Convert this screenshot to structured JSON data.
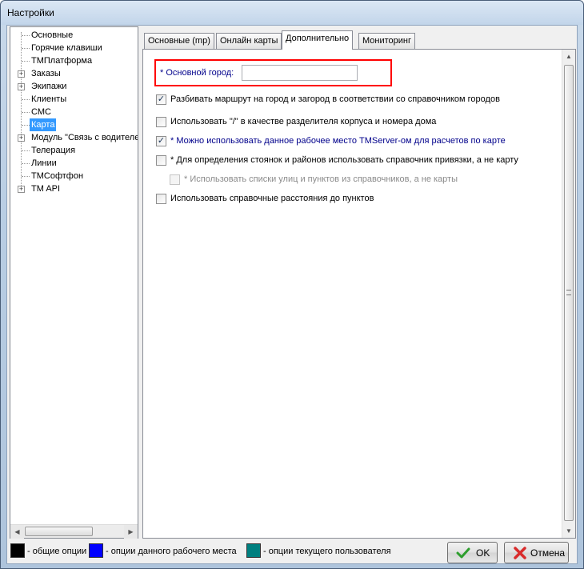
{
  "window": {
    "title": "Настройки"
  },
  "tree": {
    "items": [
      {
        "label": "Основные",
        "expandable": false,
        "selected": false
      },
      {
        "label": "Горячие клавиши",
        "expandable": false,
        "selected": false
      },
      {
        "label": "ТМПлатформа",
        "expandable": false,
        "selected": false
      },
      {
        "label": "Заказы",
        "expandable": true,
        "selected": false
      },
      {
        "label": "Экипажи",
        "expandable": true,
        "selected": false
      },
      {
        "label": "Клиенты",
        "expandable": false,
        "selected": false
      },
      {
        "label": "СМС",
        "expandable": false,
        "selected": false
      },
      {
        "label": "Карта",
        "expandable": false,
        "selected": true
      },
      {
        "label": "Модуль \"Связь с водителе",
        "expandable": true,
        "selected": false
      },
      {
        "label": "Телерация",
        "expandable": false,
        "selected": false
      },
      {
        "label": "Линии",
        "expandable": false,
        "selected": false
      },
      {
        "label": "ТМСофтфон",
        "expandable": false,
        "selected": false
      },
      {
        "label": "TM API",
        "expandable": true,
        "selected": false
      }
    ]
  },
  "tabs": [
    {
      "label": "Основные (mp)",
      "active": false
    },
    {
      "label": "Онлайн карты",
      "active": false
    },
    {
      "label": "Дополнительно",
      "active": true
    },
    {
      "label": "Мониторинг",
      "active": false
    }
  ],
  "panel": {
    "city_label": "* Основной город:",
    "city_value": "",
    "options": [
      {
        "label": "Разбивать маршрут на город и загород в соответствии со справочником  городов",
        "checked": true,
        "style": "black",
        "enabled": true
      },
      {
        "label": "Использовать \"/\" в качестве разделителя корпуса и номера дома",
        "checked": false,
        "style": "black",
        "enabled": true
      },
      {
        "label": "* Можно использовать данное рабочее место TMServer-ом для расчетов по карте",
        "checked": true,
        "style": "blue",
        "enabled": true
      },
      {
        "label": "* Для определения стоянок и районов использовать справочник привязки, а не карту",
        "checked": false,
        "style": "black",
        "enabled": true
      },
      {
        "label": "* Использовать списки улиц и пунктов из справочников, а не карты",
        "checked": false,
        "style": "gray",
        "enabled": false
      },
      {
        "label": "Использовать справочные расстояния до пунктов",
        "checked": false,
        "style": "black",
        "enabled": true
      }
    ]
  },
  "legend": [
    {
      "text": "- общие опции",
      "color": "#000000"
    },
    {
      "text": "- опции данного рабочего места",
      "color": "#0000ff"
    },
    {
      "text": "- опции текущего пользователя",
      "color": "#008080"
    }
  ],
  "buttons": {
    "ok": "OK",
    "cancel": "Отмена"
  },
  "icons": {
    "ok": "check-icon",
    "cancel": "cross-icon"
  }
}
